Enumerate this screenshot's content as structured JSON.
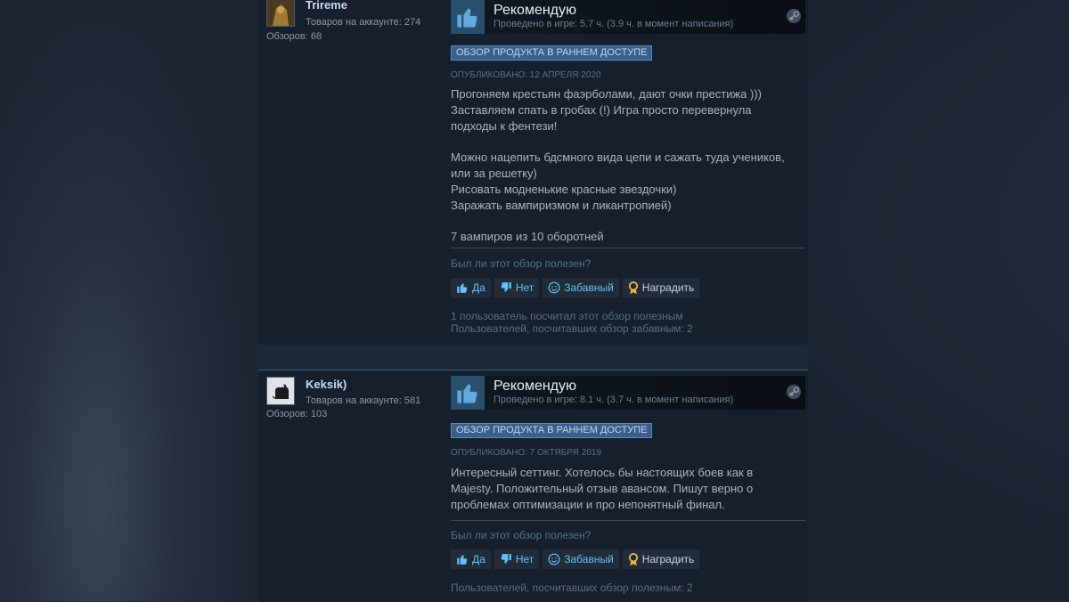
{
  "reviews": [
    {
      "author": {
        "name": "Trireme",
        "games": "Товаров на аккаунте: 274",
        "reviews": "Обзоров: 68"
      },
      "recommendation": "Рекомендую",
      "hours": "Проведено в игре: 5.7 ч. (3.9 ч. в момент написания)",
      "badge": "ОБЗОР ПРОДУКТА В РАННЕМ ДОСТУПЕ",
      "posted": "ОПУБЛИКОВАНО: 12 АПРЕЛЯ 2020",
      "text": {
        "l1": "Прогоняем крестьян фаэрболами, дают очки престижа )))",
        "l2": "Заставляем спать в гробах (!) Игра просто перевернула",
        "l3": "подходы к фентези!",
        "l4": "Можно нацепить бдсмного вида цепи и сажать туда учеников,",
        "l5": "или за решетку)",
        "l6": "Рисовать модненькие красные звездочки)",
        "l7": "Заражать вампиризмом и ликантропией)",
        "l8": "7 вампиров из 10 оборотней"
      },
      "helpful_question": "Был ли этот обзор полезен?",
      "buttons": {
        "yes": "Да",
        "no": "Нет",
        "funny": "Забавный",
        "award": "Наградить"
      },
      "stats": {
        "helpful": "1 пользователь посчитал этот обзор полезным",
        "funny": "Пользователей, посчитавших обзор забавным: 2"
      }
    },
    {
      "author": {
        "name": "Keksik)",
        "games": "Товаров на аккаунте: 581",
        "reviews": "Обзоров: 103"
      },
      "recommendation": "Рекомендую",
      "hours": "Проведено в игре: 8.1 ч. (3.7 ч. в момент написания)",
      "badge": "ОБЗОР ПРОДУКТА В РАННЕМ ДОСТУПЕ",
      "posted": "ОПУБЛИКОВАНО: 7 ОКТЯБРЯ 2019",
      "text": {
        "l1": "Интересный сеттинг. Хотелось бы настоящих боев как в",
        "l2": "Majesty. Положительный отзыв авансом. Пишут верно о",
        "l3": "проблемах оптимизации и про непонятный финал."
      },
      "helpful_question": "Был ли этот обзор полезен?",
      "buttons": {
        "yes": "Да",
        "no": "Нет",
        "funny": "Забавный",
        "award": "Наградить"
      },
      "stats": {
        "helpful": "Пользователей, посчитавших обзор полезным: 2"
      }
    }
  ],
  "colors": {
    "page_bg": "#1b2838",
    "panel_bg": "#16202d",
    "link_blue": "#66c0f4",
    "badge_bg": "#3a5f89",
    "award_gold": "#e7b73a"
  },
  "icons": {
    "recommend": "thumbs-up-icon",
    "platform": "steam-icon",
    "yes": "thumbs-up-icon",
    "no": "thumbs-down-icon",
    "funny": "smiley-icon",
    "award": "award-ribbon-icon"
  }
}
